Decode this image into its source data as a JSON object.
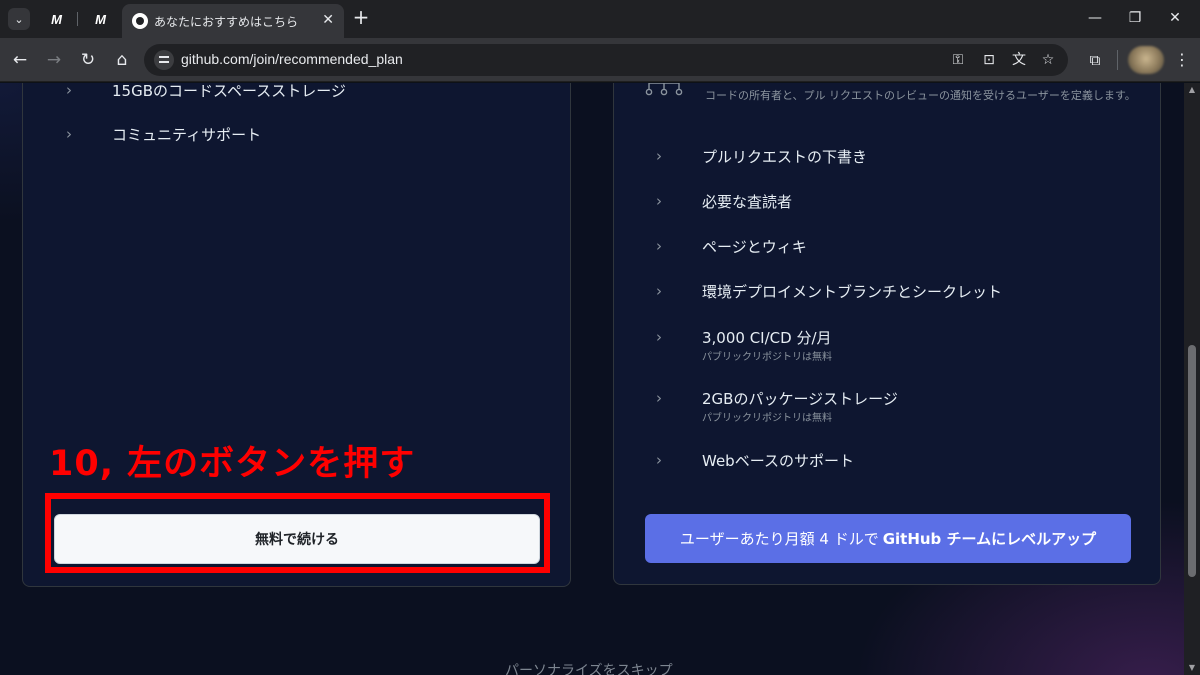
{
  "browser": {
    "pinned_tabs": [
      "M",
      "M"
    ],
    "active_tab": {
      "title": "あなたにおすすめはこちら",
      "favicon": "github-icon"
    },
    "url": "github.com/join/recommended_plan"
  },
  "left_card": {
    "features": [
      {
        "title": "15GBのコードスペースストレージ"
      },
      {
        "title": "コミュニティサポート"
      }
    ],
    "annotation": "10, 左のボタンを押す",
    "button_label": "無料で続ける"
  },
  "right_card": {
    "codeowners_description": "コードの所有者と、プル リクエストのレビューの通知を受けるユーザーを定義します。",
    "features": [
      {
        "title": "プルリクエストの下書き"
      },
      {
        "title": "必要な査読者"
      },
      {
        "title": "ページとウィキ"
      },
      {
        "title": "環境デプロイメントブランチとシークレット"
      },
      {
        "title": "3,000 CI/CD 分/月",
        "subtitle": "パブリックリポジトリは無料"
      },
      {
        "title": "2GBのパッケージストレージ",
        "subtitle": "パブリックリポジトリは無料"
      },
      {
        "title": "Webベースのサポート"
      }
    ],
    "upgrade_prefix": "ユーザーあたり月額 4 ドルで",
    "upgrade_bold": "GitHub チームにレベルアップ"
  },
  "skip_link": "パーソナライズをスキップ",
  "colors": {
    "annotation": "#ff0000",
    "upgrade_button": "#5b6fe6",
    "card_background": "#0e1630"
  }
}
